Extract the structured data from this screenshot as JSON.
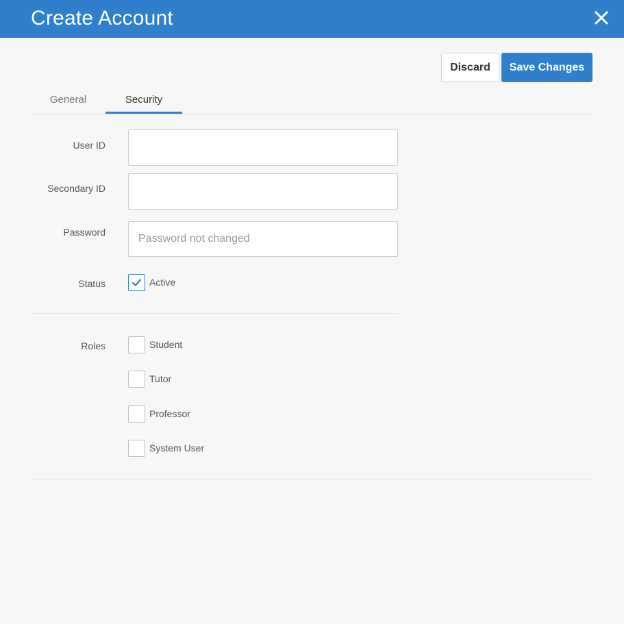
{
  "header": {
    "title": "Create Account",
    "close_icon": "close-icon"
  },
  "actions": {
    "discard_label": "Discard",
    "save_label": "Save Changes"
  },
  "tabs": [
    {
      "label": "General",
      "active": false
    },
    {
      "label": "Security",
      "active": true
    }
  ],
  "form": {
    "user_id": {
      "label": "User ID",
      "value": "",
      "placeholder": ""
    },
    "secondary_id": {
      "label": "Secondary ID",
      "value": "",
      "placeholder": ""
    },
    "password": {
      "label": "Password",
      "value": "",
      "placeholder": "Password not changed"
    },
    "status": {
      "label": "Status",
      "option_label": "Active",
      "checked": true
    }
  },
  "roles": {
    "label": "Roles",
    "options": [
      {
        "label": "Student",
        "checked": false
      },
      {
        "label": "Tutor",
        "checked": false
      },
      {
        "label": "Professor",
        "checked": false
      },
      {
        "label": "System User",
        "checked": false
      }
    ]
  },
  "colors": {
    "accent": "#2f7fcd",
    "background": "#f7f7f7"
  }
}
